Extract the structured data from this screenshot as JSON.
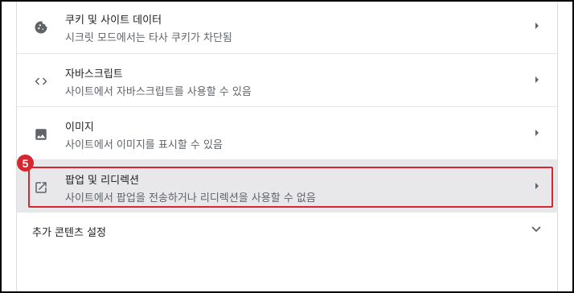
{
  "settings": {
    "items": [
      {
        "icon": "cookie-icon",
        "title": "쿠키 및 사이트 데이터",
        "subtitle": "시크릿 모드에서는 타사 쿠키가 차단됨"
      },
      {
        "icon": "code-icon",
        "title": "자바스크립트",
        "subtitle": "사이트에서 자바스크립트를 사용할 수 있음"
      },
      {
        "icon": "image-icon",
        "title": "이미지",
        "subtitle": "사이트에서 이미지를 표시할 수 있음"
      },
      {
        "icon": "open-in-new-icon",
        "title": "팝업 및 리디렉션",
        "subtitle": "사이트에서 팝업을 전송하거나 리디렉션을 사용할 수 없음"
      }
    ],
    "additional_section_label": "추가 콘텐츠 설정"
  },
  "annotation": {
    "step_number": "5",
    "highlight_color": "#d6262f"
  }
}
